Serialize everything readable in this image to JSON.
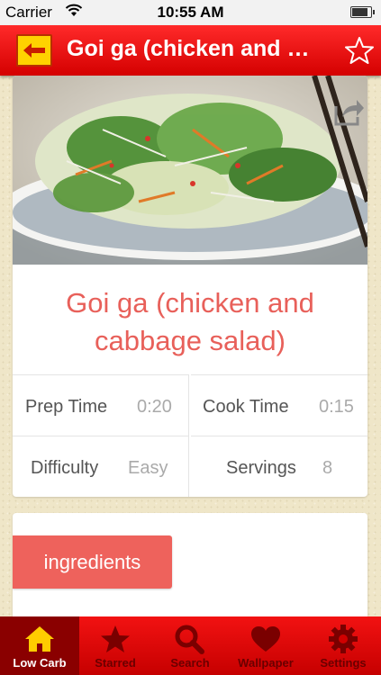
{
  "status_bar": {
    "carrier": "Carrier",
    "time": "10:55 AM"
  },
  "nav": {
    "title": "Goi ga (chicken and cabbage salad)"
  },
  "recipe": {
    "title": "Goi ga (chicken and cabbage salad)",
    "prep_label": "Prep Time",
    "prep_value": "0:20",
    "cook_label": "Cook Time",
    "cook_value": "0:15",
    "difficulty_label": "Difficulty",
    "difficulty_value": "Easy",
    "servings_label": "Servings",
    "servings_value": "8"
  },
  "sections": {
    "ingredients_label": "ingredients"
  },
  "tabs": [
    {
      "label": "Low Carb",
      "icon": "home-icon",
      "active": true
    },
    {
      "label": "Starred",
      "icon": "star-icon",
      "active": false
    },
    {
      "label": "Search",
      "icon": "search-icon",
      "active": false
    },
    {
      "label": "Wallpaper",
      "icon": "heart-icon",
      "active": false
    },
    {
      "label": "Settings",
      "icon": "gear-icon",
      "active": false
    }
  ],
  "colors": {
    "accent": "#e8605a",
    "nav_red": "#e60000",
    "back_yellow": "#ffd200"
  }
}
